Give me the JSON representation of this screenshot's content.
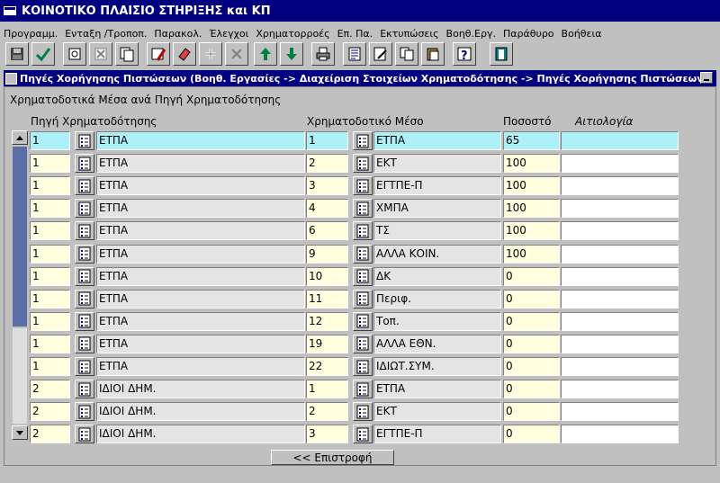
{
  "window": {
    "title": "ΚΟΙΝΟΤΙΚΟ ΠΛΑΙΣΙΟ ΣΤΗΡΙΞΗΣ και ΚΠ"
  },
  "menu": [
    "Προγραμμ.",
    "Ενταξη /Τροποπ.",
    "Παρακολ.",
    "Έλεγχοι",
    "Χρηματορροές",
    "Επ. Πα.",
    "Εκτυπώσεις",
    "Βοηθ.Εργ.",
    "Παράθυρο",
    "Βοήθεια"
  ],
  "subwindow": {
    "title": "Πηγές Χορήγησης Πιστώσεων (Βοηθ. Εργασίες -> Διαχείριση Στοιχείων Χρηματοδότησης -> Πηγές Χορήγησης Πιστώσεων)"
  },
  "form": {
    "group_label": "Χρηματοδοτικά Μέσα ανά Πηγή Χρηματοδότησης",
    "headers": {
      "source": "Πηγή Χρηματοδότησης",
      "instrument": "Χρηματοδοτικό Μέσο",
      "percent": "Ποσοστό",
      "reason": "Αιτιολογία"
    },
    "rows": [
      {
        "src_code": "1",
        "src_name": "ΕΤΠΑ",
        "ins_code": "1",
        "ins_name": "ΕΤΠΑ",
        "pct": "65",
        "reason": ""
      },
      {
        "src_code": "1",
        "src_name": "ΕΤΠΑ",
        "ins_code": "2",
        "ins_name": "ΕΚΤ",
        "pct": "100",
        "reason": ""
      },
      {
        "src_code": "1",
        "src_name": "ΕΤΠΑ",
        "ins_code": "3",
        "ins_name": "ΕΓΤΠΕ-Π",
        "pct": "100",
        "reason": ""
      },
      {
        "src_code": "1",
        "src_name": "ΕΤΠΑ",
        "ins_code": "4",
        "ins_name": "ΧΜΠΑ",
        "pct": "100",
        "reason": ""
      },
      {
        "src_code": "1",
        "src_name": "ΕΤΠΑ",
        "ins_code": "6",
        "ins_name": "ΤΣ",
        "pct": "100",
        "reason": ""
      },
      {
        "src_code": "1",
        "src_name": "ΕΤΠΑ",
        "ins_code": "9",
        "ins_name": "ΑΛΛΑ ΚΟΙΝ.",
        "pct": "100",
        "reason": ""
      },
      {
        "src_code": "1",
        "src_name": "ΕΤΠΑ",
        "ins_code": "10",
        "ins_name": "ΔΚ",
        "pct": "0",
        "reason": ""
      },
      {
        "src_code": "1",
        "src_name": "ΕΤΠΑ",
        "ins_code": "11",
        "ins_name": "Περιφ.",
        "pct": "0",
        "reason": ""
      },
      {
        "src_code": "1",
        "src_name": "ΕΤΠΑ",
        "ins_code": "12",
        "ins_name": "Τοπ.",
        "pct": "0",
        "reason": ""
      },
      {
        "src_code": "1",
        "src_name": "ΕΤΠΑ",
        "ins_code": "19",
        "ins_name": "ΑΛΛΑ ΕΘΝ.",
        "pct": "0",
        "reason": ""
      },
      {
        "src_code": "1",
        "src_name": "ΕΤΠΑ",
        "ins_code": "22",
        "ins_name": "ΙΔΙΩΤ.ΣΥΜ.",
        "pct": "0",
        "reason": ""
      },
      {
        "src_code": "2",
        "src_name": "ΙΔΙΟΙ ΔΗΜ.",
        "ins_code": "1",
        "ins_name": "ΕΤΠΑ",
        "pct": "0",
        "reason": ""
      },
      {
        "src_code": "2",
        "src_name": "ΙΔΙΟΙ ΔΗΜ.",
        "ins_code": "2",
        "ins_name": "ΕΚΤ",
        "pct": "0",
        "reason": ""
      },
      {
        "src_code": "2",
        "src_name": "ΙΔΙΟΙ ΔΗΜ.",
        "ins_code": "3",
        "ins_name": "ΕΓΤΠΕ-Π",
        "pct": "0",
        "reason": ""
      }
    ],
    "back_label": "<< Επιστροφή"
  },
  "toolbar_icons": [
    "save-icon",
    "commit-check-icon",
    "enter-query-icon",
    "cancel-query-icon",
    "execute-query-icon",
    "clear-form-icon",
    "insert-record-icon",
    "delete-record-icon",
    "previous-record-icon",
    "next-record-icon",
    "print-icon",
    "list-values-icon",
    "edit-icon",
    "copy-icon",
    "paste-icon",
    "help-icon",
    "exit-icon"
  ],
  "colors": {
    "title_bg": "#000080",
    "current_row": "#aef0f8",
    "code_field": "#ffffe0",
    "name_field": "#e4e4e4",
    "scroll_thumb": "#5c6ea8"
  }
}
